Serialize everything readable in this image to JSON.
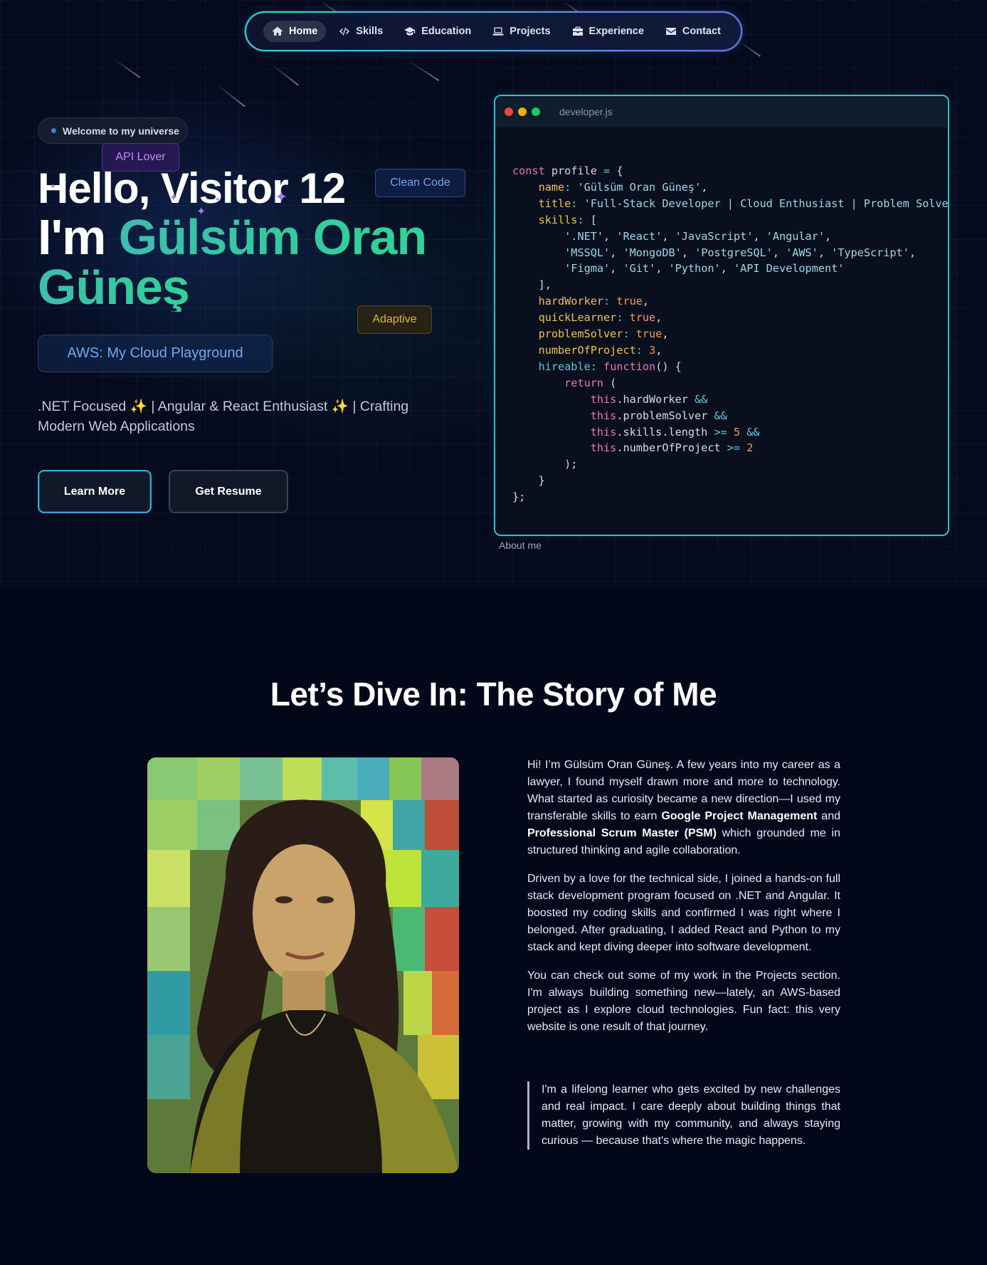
{
  "nav": {
    "items": [
      {
        "label": "Home",
        "icon": "home-icon",
        "active": true
      },
      {
        "label": "Skills",
        "icon": "code-icon"
      },
      {
        "label": "Education",
        "icon": "graduation-cap-icon"
      },
      {
        "label": "Projects",
        "icon": "laptop-icon"
      },
      {
        "label": "Experience",
        "icon": "briefcase-icon"
      },
      {
        "label": "Contact",
        "icon": "envelope-icon"
      }
    ]
  },
  "hero": {
    "welcome_badge": "Welcome to my universe",
    "chips": {
      "api": "API Lover",
      "clean": "Clean Code",
      "adaptive": "Adaptive"
    },
    "greeting": "Hello, Visitor 12",
    "im": "I'm",
    "name_part1": "Gülsüm Oran",
    "name_part2": "Güneş",
    "aws_pill": "AWS: My Cloud Playground",
    "tagline": ".NET Focused ✨ | Angular & React Enthusiast ✨ | Crafting Modern Web Applications",
    "buttons": {
      "learn_more": "Learn More",
      "get_resume": "Get Resume"
    }
  },
  "code_window": {
    "filename": "developer.js",
    "caption": "About me",
    "profile": {
      "name": "Gülsüm Oran Güneş",
      "title": "Full-Stack Developer | Cloud Enthusiast | Problem Solver",
      "skills_row1": [
        "'.NET'",
        "'React'",
        "'JavaScript'",
        "'Angular'"
      ],
      "skills_row2": [
        "'MSSQL'",
        "'MongoDB'",
        "'PostgreSQL'",
        "'AWS'",
        "'TypeScript'"
      ],
      "skills_row3": [
        "'Figma'",
        "'Git'",
        "'Python'",
        "'API Development'"
      ],
      "hardWorker": "true",
      "quickLearner": "true",
      "problemSolver": "true",
      "numberOfProject": "3",
      "min_skills": "5",
      "min_projects": "2"
    }
  },
  "story": {
    "title": "Let’s Dive In: The Story of Me",
    "photo_alt": "Portrait photo",
    "p1_a": "Hi! I’m Gülsüm Oran Güneş. A few years into my career as a lawyer, I found myself drawn more and more to technology. What started as curiosity became a new direction—I used my transferable skills to earn ",
    "p1_b1": "Google Project Management",
    "p1_c": " and ",
    "p1_b2": "Professional Scrum Master (PSM)",
    "p1_d": " which grounded me in structured thinking and agile collaboration.",
    "p2": "Driven by a love for the technical side, I joined a hands-on full stack development program focused on .NET and Angular. It boosted my coding skills and confirmed I was right where I belonged. After graduating, I added React and Python to my stack and kept diving deeper into software development.",
    "p3": "You can check out some of my work in the Projects section. I'm always building something new—lately, an AWS-based project as I explore cloud technologies. Fun fact: this very website is one result of that journey.",
    "quote": "I'm a lifelong learner who gets excited by new challenges and real impact. I care deeply about building things that matter, growing with my community, and always staying curious — because that's where the magic happens."
  },
  "colors": {
    "accent_teal": "#2fc3c9",
    "accent_purple": "#6a6af0",
    "name_gradient": "#3fbcae",
    "background": "#03071a"
  }
}
